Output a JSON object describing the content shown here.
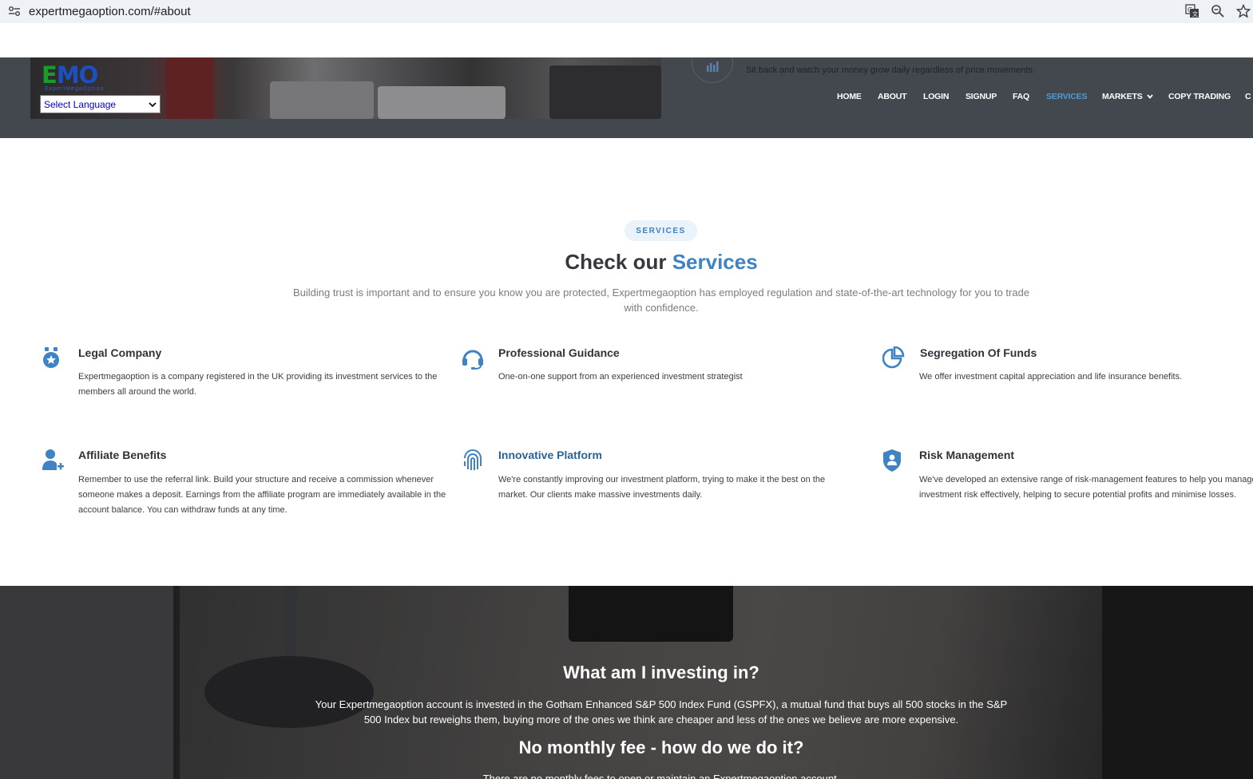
{
  "browser": {
    "url": "expertmegaoption.com/#about",
    "icons": [
      "site-settings-icon",
      "translate-icon",
      "zoom-icon",
      "bookmark-star-icon"
    ]
  },
  "header": {
    "logo_text_a": "E",
    "logo_text_b": "MO",
    "logo_sub": "ExpertMegaOption",
    "language_select": "Select Language",
    "tagline": "Sit back and watch your money grow daily regardless of price movements.",
    "nav": [
      {
        "label": "HOME",
        "active": false
      },
      {
        "label": "ABOUT",
        "active": false
      },
      {
        "label": "LOGIN",
        "active": false
      },
      {
        "label": "SIGNUP",
        "active": false
      },
      {
        "label": "FAQ",
        "active": false
      },
      {
        "label": "SERVICES",
        "active": true
      },
      {
        "label": "MARKETS",
        "active": false,
        "dropdown": true
      },
      {
        "label": "COPY TRADING",
        "active": false
      },
      {
        "label": "C",
        "active": false
      }
    ]
  },
  "services": {
    "pill": "SERVICES",
    "title_a": "Check our ",
    "title_b": "Services",
    "description": "Building trust is important and to ensure you know you are protected, Expertmegaoption has employed regulation and state-of-the-art technology for you to trade with confidence.",
    "cards": [
      {
        "icon": "medal-icon",
        "title": "Legal Company",
        "text": "Expertmegaoption is a company registered in the UK providing its investment services to the members all around the world."
      },
      {
        "icon": "headset-icon",
        "title": "Professional Guidance",
        "text": "One-on-one support from an experienced investment strategist"
      },
      {
        "icon": "pie-chart-icon",
        "title": "Segregation Of Funds",
        "text": "We offer investment capital appreciation and life insurance benefits."
      },
      {
        "icon": "user-plus-icon",
        "title": "Affiliate Benefits",
        "text": "Remember to use the referral link. Build your structure and receive a commission whenever someone makes a deposit. Earnings from the affiliate program are immediately available in the account balance. You can withdraw funds at any time."
      },
      {
        "icon": "fingerprint-icon",
        "title": "Innovative Platform",
        "text": "We're constantly improving our investment platform, trying to make it the best on the market. Our clients make massive investments daily."
      },
      {
        "icon": "shield-user-icon",
        "title": "Risk Management",
        "text": "We've developed an extensive range of risk-management features to help you manage investment risk effectively, helping to secure potential profits and minimise losses."
      }
    ]
  },
  "investing": {
    "heading1": "What am I investing in?",
    "paragraph1": "Your Expertmegaoption account is invested in the Gotham Enhanced S&P 500 Index Fund (GSPFX), a mutual fund that buys all 500 stocks in the S&P 500 Index but reweighs them, buying more of the ones we think are cheaper and less of the ones we believe are more expensive.",
    "heading2": "No monthly fee - how do we do it?",
    "paragraph2": "There are no monthly fees to open or maintain an Expertmegaoption account."
  },
  "colors": {
    "accent": "#3f83c4",
    "header_bg": "#43484e",
    "nav_active": "#4f9ad8",
    "logo_green": "#1a9c2b",
    "logo_blue": "#1c4fbf"
  }
}
